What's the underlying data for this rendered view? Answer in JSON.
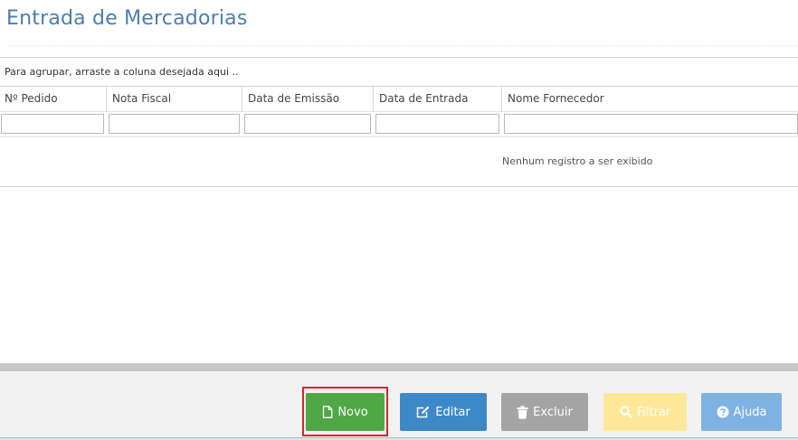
{
  "page": {
    "title": "Entrada de Mercadorias"
  },
  "grid": {
    "group_hint": "Para agrupar, arraste a coluna desejada aqui ..",
    "columns": [
      "Nº Pedido",
      "Nota Fiscal",
      "Data de Emissão",
      "Data de Entrada",
      "Nome Fornecedor"
    ],
    "empty_message": "Nenhum registro a ser exibido"
  },
  "toolbar": {
    "novo_label": "Novo",
    "editar_label": "Editar",
    "excluir_label": "Excluir",
    "filtrar_label": "Filtrar",
    "ajuda_label": "Ajuda"
  },
  "icons": {
    "novo": "file-icon",
    "editar": "edit-icon",
    "excluir": "trash-icon",
    "filtrar": "search-icon",
    "ajuda": "help-icon"
  },
  "colors": {
    "title": "#4a7eae",
    "novo": "#4fa845",
    "editar": "#3d88c7",
    "excluir": "#a4a4a4",
    "filtrar": "#fde89a",
    "ajuda": "#7fb2e2",
    "focus": "#d0282e"
  }
}
